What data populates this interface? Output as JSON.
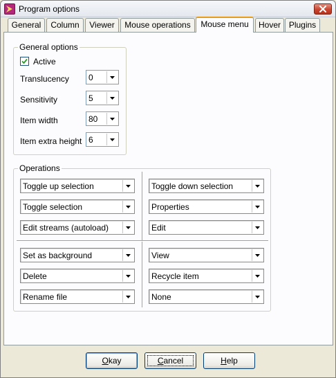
{
  "window": {
    "title": "Program options"
  },
  "tabs": [
    {
      "label": "General"
    },
    {
      "label": "Column"
    },
    {
      "label": "Viewer"
    },
    {
      "label": "Mouse operations"
    },
    {
      "label": "Mouse menu",
      "active": true
    },
    {
      "label": "Hover"
    },
    {
      "label": "Plugins"
    }
  ],
  "general_options": {
    "title": "General options",
    "active_label": "Active",
    "active_checked": true,
    "translucency_label": "Translucency",
    "translucency_value": "0",
    "sensitivity_label": "Sensitivity",
    "sensitivity_value": "5",
    "item_width_label": "Item width",
    "item_width_value": "80",
    "item_extra_height_label": "Item extra height",
    "item_extra_height_value": "6"
  },
  "operations": {
    "title": "Operations",
    "left": [
      "Toggle up selection",
      "Toggle selection",
      "Edit streams (autoload)",
      "Set as background",
      "Delete",
      "Rename file"
    ],
    "right": [
      "Toggle down selection",
      "Properties",
      "Edit",
      "View",
      "Recycle item",
      "None"
    ]
  },
  "buttons": {
    "ok_prefix": "",
    "ok_mnemonic": "O",
    "ok_rest": "kay",
    "cancel_prefix": "",
    "cancel_mnemonic": "C",
    "cancel_rest": "ancel",
    "help_prefix": "",
    "help_mnemonic": "H",
    "help_rest": "elp"
  },
  "colors": {
    "window_bg": "#ece9d8",
    "panel_bg": "#fcfcfe",
    "active_tab_accent": "#e79d1b",
    "close_button": "#c9452f",
    "app_icon": "#b3287a"
  },
  "icons": {
    "app": "app-logo-icon",
    "close": "close-icon",
    "dropdown": "chevron-down-icon",
    "check": "checkmark-icon"
  }
}
